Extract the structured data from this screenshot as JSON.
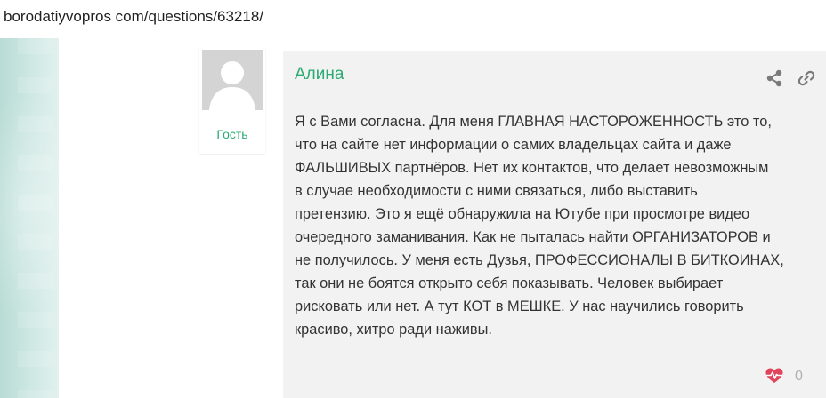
{
  "address_bar": {
    "url": "borodatiyvopros com/questions/63218/"
  },
  "author": {
    "name": "Гость",
    "avatar_icon": "user-silhouette-icon"
  },
  "comment": {
    "author": "Алина",
    "share_icon": "share-icon",
    "link_icon": "link-icon",
    "lines": [
      "Я с Вами согласна. Для меня ГЛАВНАЯ НАСТОРОЖЕННОСТЬ это то,",
      "что на сайте нет информации о самих владельцах сайта и даже",
      "ФАЛЬШИВЫХ партнёров. Нет их контактов, что делает невозможным",
      "в случае необходимости с ними связаться, либо выставить",
      "претензию. Это я ещё обнаружила на Ютубе при просмотре видео",
      "очередного заманивания. Как не пыталась найти ОРГАНИЗАТОРОВ и",
      "не получилось. У меня есть Дузья, ПРОФЕССИОНАЛЫ В БИТКОИНАХ,",
      "так они не боятся открыто себя показывать. Человек выбирает",
      "рисковать или нет. А тут КОТ в МЕШКЕ. У нас научились говорить",
      "красиво, хитро ради наживы."
    ],
    "like_icon": "heart-pulse-icon",
    "like_count": "0"
  },
  "colors": {
    "accent_green": "#2aab74",
    "like_red": "#e0435a",
    "icon_gray": "#7a7a7a",
    "comment_bg": "#f2f2f2"
  }
}
